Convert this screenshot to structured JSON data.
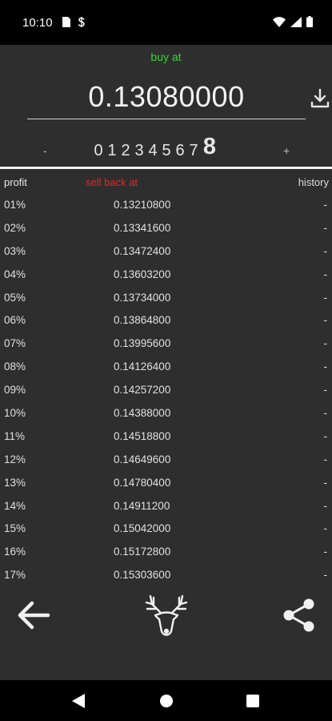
{
  "status_bar": {
    "time": "10:10"
  },
  "buy": {
    "label": "buy at",
    "price": "0.13080000"
  },
  "stepper": {
    "minus": "-",
    "plus": "+",
    "digits": [
      "0",
      "1",
      "2",
      "3",
      "4",
      "5",
      "6",
      "7",
      "8"
    ],
    "selected_index": 8
  },
  "table": {
    "headers": {
      "profit": "profit",
      "sell": "sell back at",
      "history": "history"
    },
    "rows": [
      {
        "profit": "01%",
        "value": "0.13210800",
        "history": "-"
      },
      {
        "profit": "02%",
        "value": "0.13341600",
        "history": "-"
      },
      {
        "profit": "03%",
        "value": "0.13472400",
        "history": "-"
      },
      {
        "profit": "04%",
        "value": "0.13603200",
        "history": "-"
      },
      {
        "profit": "05%",
        "value": "0.13734000",
        "history": "-"
      },
      {
        "profit": "06%",
        "value": "0.13864800",
        "history": "-"
      },
      {
        "profit": "07%",
        "value": "0.13995600",
        "history": "-"
      },
      {
        "profit": "08%",
        "value": "0.14126400",
        "history": "-"
      },
      {
        "profit": "09%",
        "value": "0.14257200",
        "history": "-"
      },
      {
        "profit": "10%",
        "value": "0.14388000",
        "history": "-"
      },
      {
        "profit": "11%",
        "value": "0.14518800",
        "history": "-"
      },
      {
        "profit": "12%",
        "value": "0.14649600",
        "history": "-"
      },
      {
        "profit": "13%",
        "value": "0.14780400",
        "history": "-"
      },
      {
        "profit": "14%",
        "value": "0.14911200",
        "history": "-"
      },
      {
        "profit": "15%",
        "value": "0.15042000",
        "history": "-"
      },
      {
        "profit": "16%",
        "value": "0.15172800",
        "history": "-"
      },
      {
        "profit": "17%",
        "value": "0.15303600",
        "history": "-"
      }
    ]
  },
  "colors": {
    "buy_label": "#37d437",
    "sell_header": "#e02a2a",
    "background": "#2e2e2e"
  },
  "icons": {
    "download": "download-icon",
    "back": "arrow-left-icon",
    "logo": "deer-head-icon",
    "share": "share-icon"
  }
}
